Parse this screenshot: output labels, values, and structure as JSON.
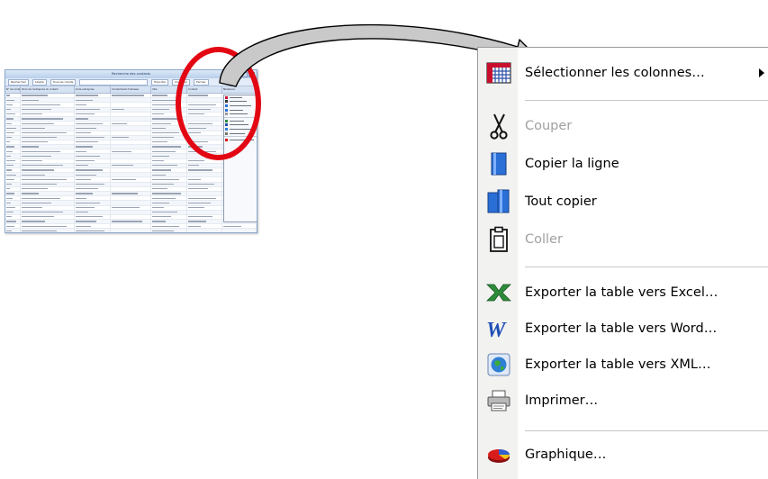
{
  "thumbnail": {
    "window_title": "Recherche des contacts",
    "toolbar": [
      "Rechercher",
      "Libellé",
      "Tous les clients",
      "Exporter",
      "Imprimer",
      "Fermer"
    ],
    "columns": [
      "N° de contact",
      "Nom de l'entreprise du contact",
      "Code entreprise",
      "Complément d'adresse",
      "Ville",
      "Contact",
      "Téléphone"
    ]
  },
  "annotation": {
    "circle_color": "#e30613",
    "arrow_fill": "#c9c9c9",
    "arrow_stroke": "#000000"
  },
  "context_menu": {
    "items": [
      {
        "id": "select-columns",
        "label": "Sélectionner les colonnes…",
        "icon": "columns-grid-icon",
        "enabled": true,
        "submenu": true
      },
      {
        "id": "cut",
        "label": "Couper",
        "icon": "scissors-icon",
        "enabled": false
      },
      {
        "id": "copy-row",
        "label": "Copier la ligne",
        "icon": "copy-icon",
        "enabled": true
      },
      {
        "id": "copy-all",
        "label": "Tout copier",
        "icon": "copy-all-icon",
        "enabled": true
      },
      {
        "id": "paste",
        "label": "Coller",
        "icon": "clipboard-icon",
        "enabled": false
      },
      {
        "id": "export-excel",
        "label": "Exporter la table vers Excel…",
        "icon": "excel-icon",
        "enabled": true
      },
      {
        "id": "export-word",
        "label": "Exporter la table vers Word…",
        "icon": "word-icon",
        "enabled": true
      },
      {
        "id": "export-xml",
        "label": "Exporter la table vers XML…",
        "icon": "xml-globe-icon",
        "enabled": true
      },
      {
        "id": "print",
        "label": "Imprimer…",
        "icon": "printer-icon",
        "enabled": true
      },
      {
        "id": "chart",
        "label": "Graphique…",
        "icon": "pie-chart-icon",
        "enabled": true
      }
    ],
    "colors": {
      "excel": "#2e8b3a",
      "word": "#1f4fb5",
      "copy": "#2a6fd6",
      "disabled_text": "#a0a0a0"
    }
  }
}
